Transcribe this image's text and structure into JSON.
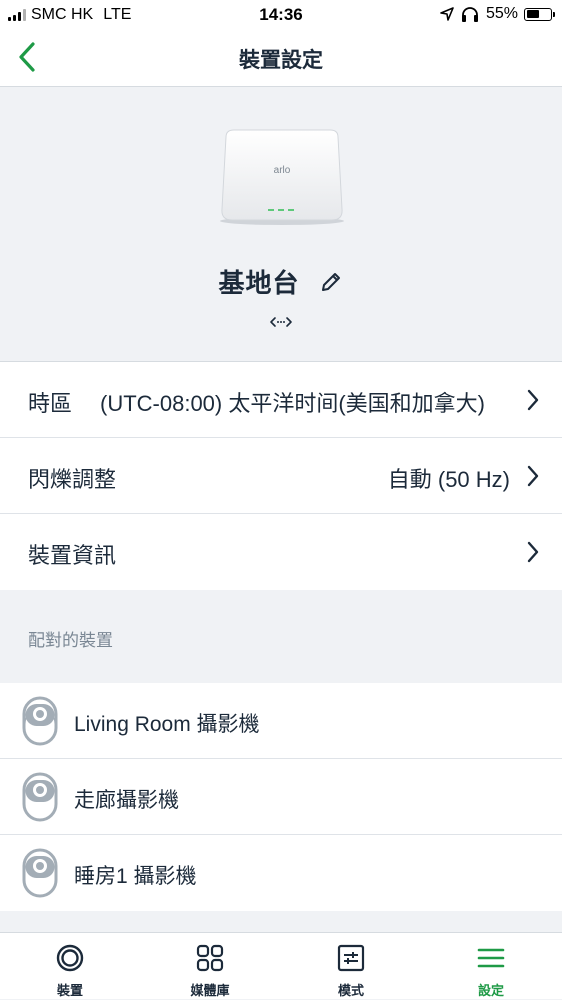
{
  "status_bar": {
    "carrier": "SMC HK",
    "network": "LTE",
    "time": "14:36",
    "battery_percent": "55%",
    "battery_level": 0.55
  },
  "nav": {
    "title": "裝置設定",
    "back_icon": "chevron-left-icon"
  },
  "hero": {
    "device_brand": "arlo",
    "device_name": "基地台",
    "edit_icon": "pencil-icon",
    "link_icon": "link-arrows-icon"
  },
  "settings": [
    {
      "label": "時區",
      "value": "(UTC-08:00) 太平洋时间(美国和加拿大)"
    },
    {
      "label": "閃爍調整",
      "value": "自動 (50 Hz)"
    },
    {
      "label": "裝置資訊",
      "value": ""
    }
  ],
  "paired_section": {
    "title": "配對的裝置",
    "devices": [
      {
        "name": "Living Room 攝影機"
      },
      {
        "name": "走廊攝影機"
      },
      {
        "name": "睡房1 攝影機"
      }
    ]
  },
  "tabbar": {
    "tabs": [
      {
        "label": "裝置",
        "icon": "camera-lens-icon"
      },
      {
        "label": "媒體庫",
        "icon": "grid-icon"
      },
      {
        "label": "模式",
        "icon": "sliders-icon"
      },
      {
        "label": "設定",
        "icon": "menu-icon"
      }
    ],
    "active_index": 3
  },
  "colors": {
    "accent": "#1e9a46",
    "text": "#1c2a3a",
    "background": "#f0f2f5",
    "muted": "#7a8794"
  }
}
